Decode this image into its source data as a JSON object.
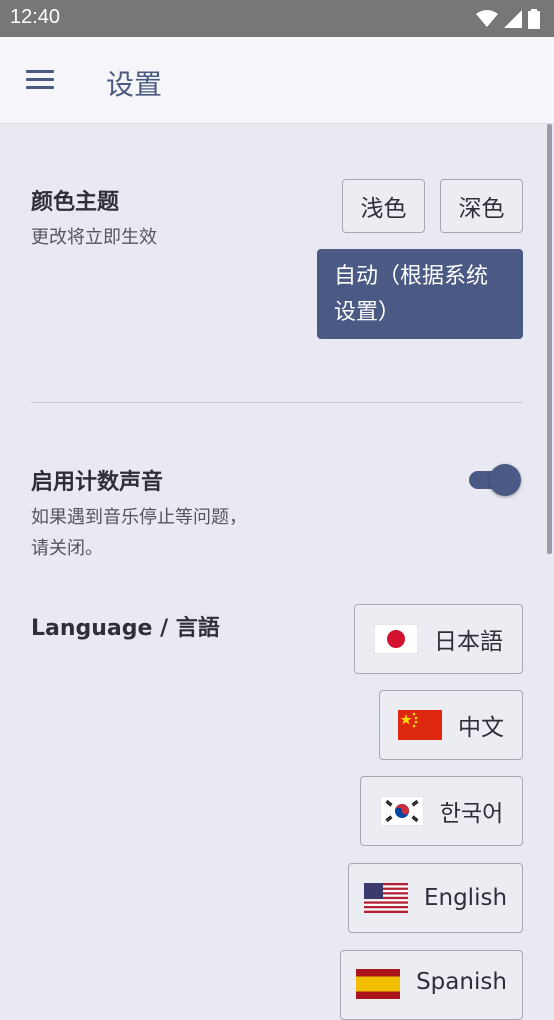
{
  "status_bar": {
    "time": "12:40"
  },
  "app_bar": {
    "title": "设置"
  },
  "theme": {
    "title": "颜色主题",
    "description": "更改将立即生效",
    "options": {
      "light": "浅色",
      "dark": "深色",
      "auto_line1": "自动（根据系统",
      "auto_line2": "设置）"
    },
    "selected": "auto"
  },
  "sound": {
    "title": "启用计数声音",
    "description_line1": "如果遇到音乐停止等问题，",
    "description_line2": "请关闭。",
    "enabled": true
  },
  "language": {
    "title": "Language / 言語",
    "options": [
      {
        "label": "日本語",
        "flag": "japan-flag-icon"
      },
      {
        "label": "中文",
        "flag": "china-flag-icon"
      },
      {
        "label": "한국어",
        "flag": "korea-flag-icon"
      },
      {
        "label": "English",
        "flag": "usa-flag-icon"
      },
      {
        "label": "Spanish",
        "flag": "spain-flag-icon"
      }
    ]
  },
  "colors": {
    "accent": "#4a5a84",
    "background": "#e9e9f1",
    "appbar": "#f6f6fa",
    "statusbar": "#777777"
  }
}
